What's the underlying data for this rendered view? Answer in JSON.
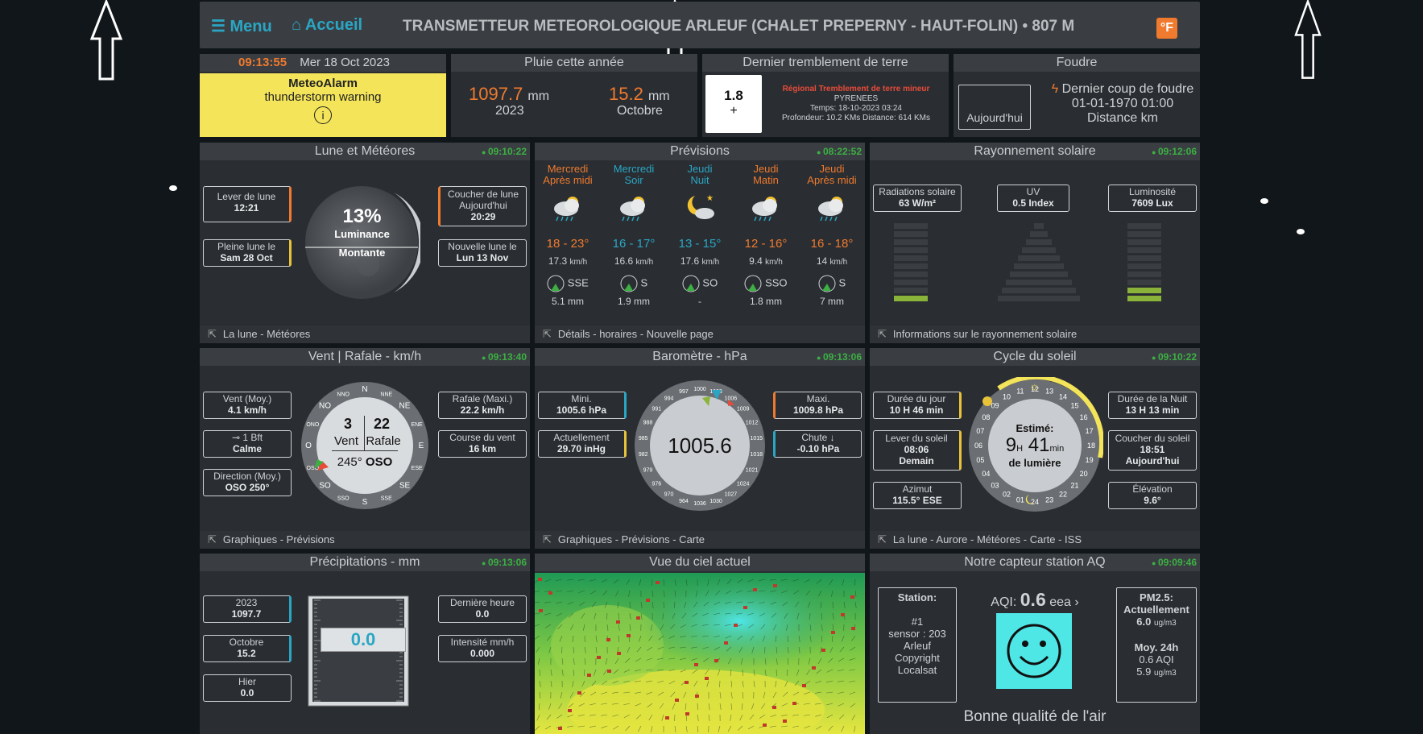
{
  "topbar": {
    "menu": "Menu",
    "home": "Accueil",
    "title": "TRANSMETTEUR METEOROLOGIQUE ARLEUF (CHALET PREPERNY - HAUT-FOLIN)  •  807 M",
    "unit": "°F"
  },
  "clock": {
    "time": "09:13:55",
    "date": "Mer 18 Oct 2023"
  },
  "alarm": {
    "title": "MeteoAlarm",
    "text": "thunderstorm warning",
    "icon": "i"
  },
  "rain_year": {
    "title": "Pluie cette année",
    "year_value": "1097.7",
    "year_unit": "mm",
    "year_label": "2023",
    "month_value": "15.2",
    "month_unit": "mm",
    "month_label": "Octobre"
  },
  "quake": {
    "title": "Dernier tremblement de terre",
    "magnitude": "1.8",
    "headline": "Régional Tremblement de terre mineur",
    "region": "PYRENEES",
    "time": "Temps: 18-10-2023 03:24",
    "depth": "Profondeur: 10.2 KMs Distance: 614 KMs"
  },
  "lightning": {
    "title": "Foudre",
    "today": "Aujourd'hui",
    "last": "Dernier coup de foudre",
    "date": "01-01-1970 01:00",
    "distance": "Distance km"
  },
  "moon": {
    "title": "Lune et Météores",
    "stamp": "09:10:22",
    "rise_label": "Lever de lune",
    "rise": "12:21",
    "set_label": "Coucher de lune",
    "set_day": "Aujourd'hui",
    "set": "20:29",
    "full_label": "Pleine lune le",
    "full": "Sam 28 Oct",
    "new_label": "Nouvelle lune le",
    "new": "Lun 13 Nov",
    "percent": "13%",
    "luminance": "Luminance",
    "phase": "Montante",
    "footer": "La lune - Météores"
  },
  "forecast": {
    "title": "Prévisions",
    "stamp": "08:22:52",
    "footer": "Détails - horaires - Nouvelle page",
    "days": [
      {
        "d1": "Mercredi",
        "d2": "Après midi",
        "temp": "18 - 23°",
        "wind": "17.3",
        "wunit": "km/h",
        "dir": "SSE",
        "rain": "5.1 mm",
        "color": "#f07a2e",
        "icon": "rain-cloud-icon"
      },
      {
        "d1": "Mercredi",
        "d2": "Soir",
        "temp": "16 - 17°",
        "wind": "16.6",
        "wunit": "km/h",
        "dir": "S",
        "rain": "1.9 mm",
        "color": "#2aa6c4",
        "icon": "rain-cloud-icon"
      },
      {
        "d1": "Jeudi",
        "d2": "Nuit",
        "temp": "13 - 15°",
        "wind": "17.6",
        "wunit": "km/h",
        "dir": "SO",
        "rain": "-",
        "color": "#2aa6c4",
        "icon": "moon-cloud-icon"
      },
      {
        "d1": "Jeudi",
        "d2": "Matin",
        "temp": "12 - 16°",
        "wind": "9.4",
        "wunit": "km/h",
        "dir": "SSO",
        "rain": "1.8 mm",
        "color": "#f07a2e",
        "icon": "rain-cloud-icon"
      },
      {
        "d1": "Jeudi",
        "d2": "Après midi",
        "temp": "16 - 18°",
        "wind": "14",
        "wunit": "km/h",
        "dir": "S",
        "rain": "7 mm",
        "color": "#f07a2e",
        "icon": "rain-cloud-icon"
      }
    ]
  },
  "solar": {
    "title": "Rayonnement solaire",
    "stamp": "09:12:06",
    "rad_label": "Radiations solaire",
    "rad": "63 W/m²",
    "uv_label": "UV",
    "uv": "0.5 Index",
    "lum_label": "Luminosité",
    "lum": "7609 Lux",
    "footer": "Informations sur le rayonnement solaire"
  },
  "wind": {
    "title": "Vent | Rafale - km/h",
    "stamp": "09:13:40",
    "avg_label": "Vent (Moy.)",
    "avg": "4.1 km/h",
    "bft": "1 Bft",
    "bft_text": "Calme",
    "dir_label": "Direction (Moy.)",
    "dir": "OSO 250°",
    "gust_label": "Rafale (Maxi.)",
    "gust": "22.2 km/h",
    "run_label": "Course du vent",
    "run": "16 km",
    "speed": "3",
    "gust_val": "22",
    "speed_lbl": "Vent",
    "gust_lbl": "Rafale",
    "heading": "245°",
    "heading_dir": "OSO",
    "footer": "Graphiques - Prévisions",
    "compass": [
      "N",
      "NNE",
      "NE",
      "ENE",
      "E",
      "ESE",
      "SE",
      "SSE",
      "S",
      "SSO",
      "SO",
      "OSO",
      "O",
      "ONO",
      "NO",
      "NNO"
    ]
  },
  "baro": {
    "title": "Baromètre - hPa",
    "stamp": "09:13:06",
    "min_label": "Mini.",
    "min": "1005.6 hPa",
    "max_label": "Maxi.",
    "max": "1009.8 hPa",
    "cur_label": "Actuellement",
    "cur": "29.70 inHg",
    "trend_label": "Chute ↓",
    "trend": "-0.10 hPa",
    "value": "1005.6",
    "footer": "Graphiques - Prévisions - Carte",
    "ticks": [
      "1000",
      "1003",
      "1006",
      "1009",
      "1012",
      "1015",
      "1018",
      "1021",
      "1024",
      "1027",
      "1030",
      "1036",
      "964",
      "970",
      "976",
      "979",
      "982",
      "985",
      "988",
      "991",
      "994",
      "997"
    ]
  },
  "sun": {
    "title": "Cycle du soleil",
    "stamp": "09:10:22",
    "day_label": "Durée du jour",
    "day": "10 H 46 min",
    "night_label": "Durée de la Nuit",
    "night": "13 H 13 min",
    "rise_label": "Lever du soleil",
    "rise": "08:06",
    "rise_day": "Demain",
    "set_label": "Coucher du soleil",
    "set": "18:51",
    "set_day": "Aujourd'hui",
    "az_label": "Azimut",
    "az": "115.5° ESE",
    "el_label": "Élévation",
    "el": "9.6°",
    "est": "Estimé:",
    "h": "9",
    "hu": "H",
    "m": "41",
    "mu": "min",
    "light": "de lumière",
    "footer": "La lune - Aurore - Météores - Carte - ISS",
    "hours": [
      "13",
      "14",
      "15",
      "16",
      "17",
      "18",
      "19",
      "20",
      "21",
      "22",
      "23",
      "24",
      "01",
      "02",
      "03",
      "04",
      "05",
      "06",
      "07",
      "08",
      "09",
      "10",
      "11",
      "12"
    ]
  },
  "precip": {
    "title": "Précipitations - mm",
    "stamp": "09:13:06",
    "y_label": "2023",
    "y": "1097.7",
    "m_label": "Octobre",
    "m": "15.2",
    "h_label": "Hier",
    "h": "0.0",
    "last_label": "Dernière heure",
    "last": "0.0",
    "int_label": "Intensité mm/h",
    "int": "0.000",
    "value": "0.0"
  },
  "sky": {
    "title": "Vue du ciel actuel"
  },
  "aq": {
    "title": "Notre capteur station AQ",
    "stamp": "09:09:46",
    "station_label": "Station:",
    "station": "#1",
    "sensor": "sensor : 203",
    "place": "Arleuf",
    "copyright": "Copyright",
    "owner": "Localsat",
    "aqi_label": "AQI:",
    "aqi": "0.6",
    "eea": "eea",
    "pm_label": "PM2.5:",
    "pm_now": "Actuellement",
    "pm": "6.0",
    "pm_unit": "ug/m3",
    "avg_label": "Moy. 24h",
    "avg_aqi": "0.6 AQI",
    "avg": "5.9",
    "avg_unit": "ug/m3",
    "quality": "Bonne qualité de l'air"
  }
}
